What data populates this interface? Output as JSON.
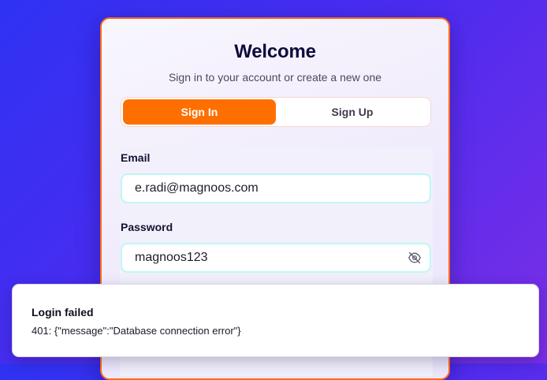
{
  "card": {
    "title": "Welcome",
    "subtitle": "Sign in to your account or create a new one"
  },
  "tabs": [
    {
      "label": "Sign In",
      "active": true
    },
    {
      "label": "Sign Up",
      "active": false
    }
  ],
  "form": {
    "email_label": "Email",
    "email_value": "e.radi@magnoos.com",
    "password_label": "Password",
    "password_value": "magnoos123",
    "password_toggle_icon": "eye-off-icon"
  },
  "toast": {
    "title": "Login failed",
    "message": "401: {\"message\":\"Database connection error\"}"
  },
  "colors": {
    "accent": "#ff6f00",
    "card_border": "#ff6a1a",
    "input_border": "#bff6f4",
    "background_start": "#2f32f3",
    "background_end": "#7a2ee6"
  }
}
